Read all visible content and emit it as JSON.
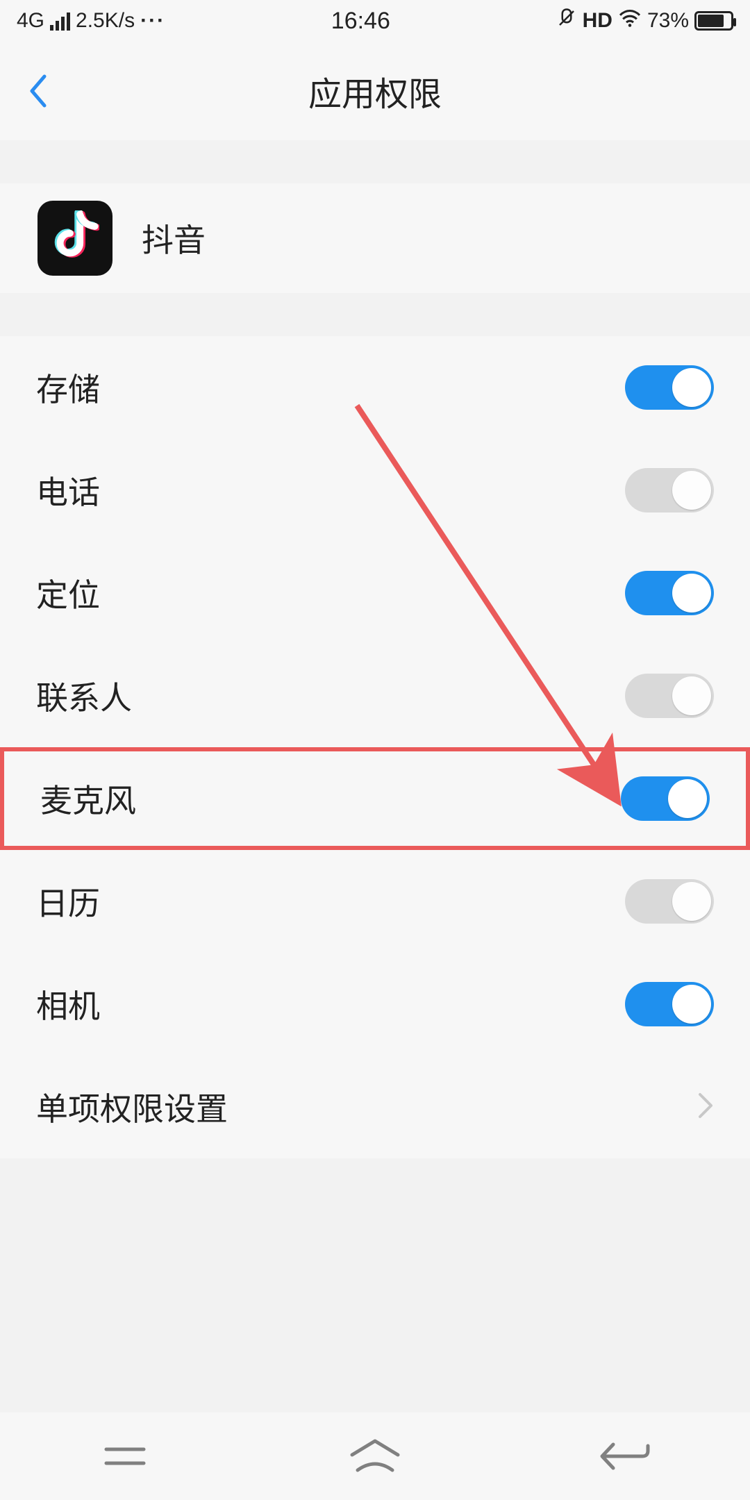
{
  "statusbar": {
    "network": "4G",
    "speed": "2.5K/s",
    "time": "16:46",
    "hd": "HD",
    "battery_pct": "73%"
  },
  "header": {
    "title": "应用权限"
  },
  "app": {
    "name": "抖音"
  },
  "permissions": [
    {
      "label": "存储",
      "on": true,
      "hl": false
    },
    {
      "label": "电话",
      "on": false,
      "hl": false
    },
    {
      "label": "定位",
      "on": true,
      "hl": false
    },
    {
      "label": "联系人",
      "on": false,
      "hl": false
    },
    {
      "label": "麦克风",
      "on": true,
      "hl": true
    },
    {
      "label": "日历",
      "on": false,
      "hl": false
    },
    {
      "label": "相机",
      "on": true,
      "hl": false
    }
  ],
  "more_row": {
    "label": "单项权限设置"
  }
}
